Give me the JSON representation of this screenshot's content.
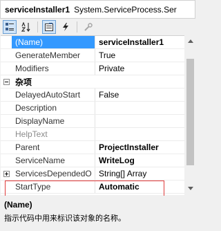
{
  "header": {
    "object_name": "serviceInstaller1",
    "object_type": "System.ServiceProcess.Ser"
  },
  "toolbar": {
    "buttons": [
      {
        "icon": "categorized-icon",
        "active": true
      },
      {
        "icon": "alphabetical-sort-icon",
        "active": false
      },
      {
        "icon": "properties-icon",
        "active": true
      },
      {
        "icon": "events-lightning-icon",
        "active": false
      },
      {
        "icon": "property-pages-wrench-icon",
        "active": false
      }
    ]
  },
  "grid": {
    "rows": [
      {
        "kind": "prop",
        "name": "(Name)",
        "value": "serviceInstaller1",
        "selected": true,
        "bold": true
      },
      {
        "kind": "prop",
        "name": "GenerateMember",
        "value": "True"
      },
      {
        "kind": "prop",
        "name": "Modifiers",
        "value": "Private"
      },
      {
        "kind": "category",
        "name": "杂项"
      },
      {
        "kind": "prop",
        "name": "DelayedAutoStart",
        "value": "False"
      },
      {
        "kind": "prop",
        "name": "Description",
        "value": ""
      },
      {
        "kind": "prop",
        "name": "DisplayName",
        "value": ""
      },
      {
        "kind": "prop",
        "name": "HelpText",
        "value": "",
        "muted": true
      },
      {
        "kind": "prop",
        "name": "Parent",
        "value": "ProjectInstaller",
        "bold": true
      },
      {
        "kind": "prop",
        "name": "ServiceName",
        "value": "WriteLog",
        "bold": true
      },
      {
        "kind": "prop",
        "name": "ServicesDependedO",
        "value": "String[] Array",
        "expandable": true
      },
      {
        "kind": "prop",
        "name": "StartType",
        "value": "Automatic",
        "bold": true,
        "highlighted": true
      }
    ]
  },
  "description": {
    "title": "(Name)",
    "text": "指示代码中用来标识该对象的名称。"
  },
  "colors": {
    "selection": "#3399ff",
    "highlight_border": "#e03a3a"
  }
}
